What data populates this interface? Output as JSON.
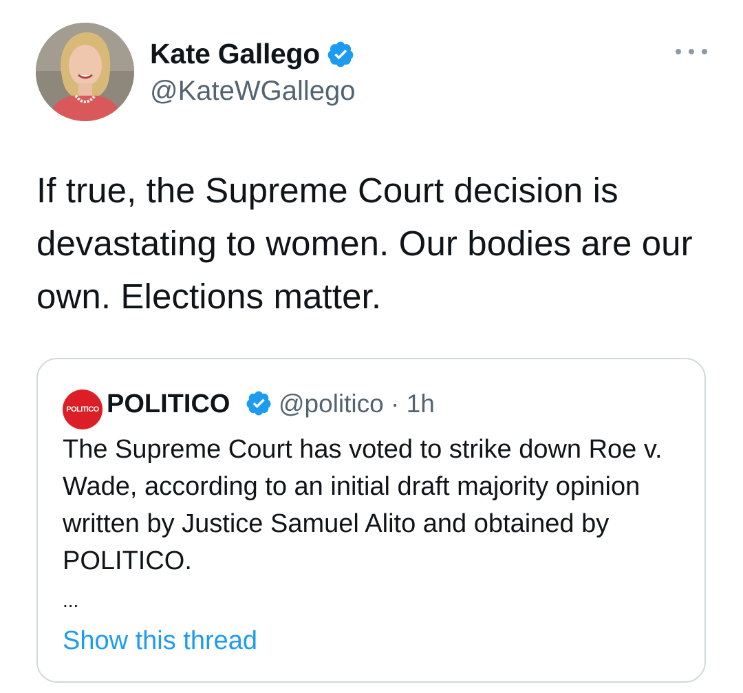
{
  "tweet": {
    "author_name": "Kate Gallego",
    "author_handle": "@KateWGallego",
    "text": "If true, the Supreme Court decision is devastating to women. Our bodies are our own. Elections matter."
  },
  "quote": {
    "logo_text": "POLITICO",
    "author_name": "POLITICO",
    "meta": "@politico · 1h",
    "text": "The Supreme Court has voted to strike down Roe v. Wade, according to an initial draft majority opinion written by Justice Samuel Alito and obtained by POLITICO.",
    "ellipsis": "...",
    "show_thread_label": "Show this thread"
  },
  "colors": {
    "verified": "#1d9bf0",
    "link": "#1d9bf0",
    "secondary_text": "#536471",
    "politico_red": "#dc1f26"
  }
}
